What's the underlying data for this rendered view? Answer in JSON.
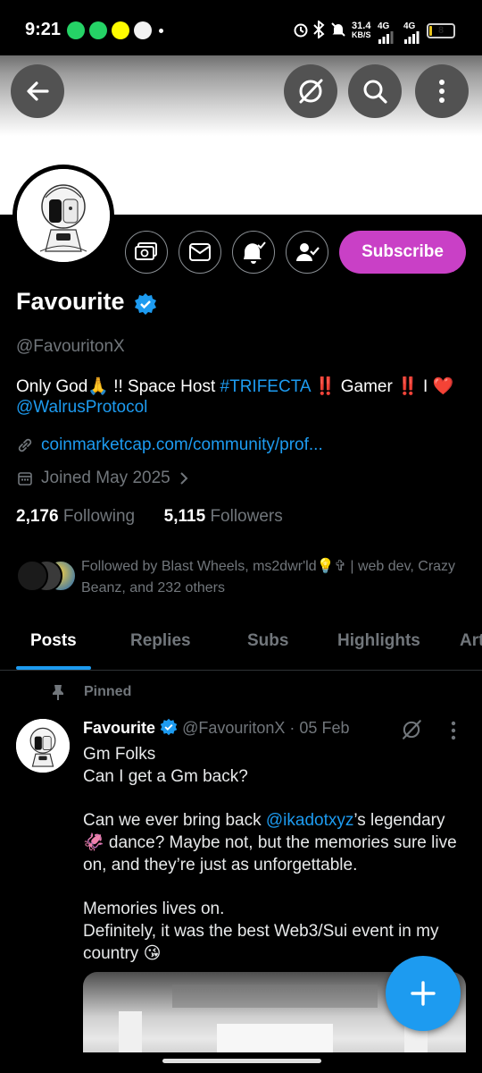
{
  "status_bar": {
    "time": "9:21",
    "net_speed_top": "31.4",
    "net_speed_unit": "KB/S",
    "signal1_label": "4G",
    "signal2_label": "4G",
    "battery_level": "8",
    "battery_fraction": 0.08,
    "colors": {
      "battery_fill": "#e8c31b"
    }
  },
  "header": {
    "back_icon": "arrow-left-icon",
    "grok_icon": "slash-circle-icon",
    "search_icon": "search-icon",
    "more_icon": "more-vertical-icon"
  },
  "profile": {
    "display_name": "Favourite",
    "handle": "@FavouritonX",
    "bio": {
      "part1": "Only God🙏 !! Space Host ",
      "hashtag": "#TRIFECTA",
      "part2": " ‼️ Gamer ‼️ I ❤️",
      "mention": "@WalrusProtocol"
    },
    "website": "coinmarketcap.com/community/prof...",
    "joined": "Joined May 2025",
    "following_count": "2,176",
    "following_label": "Following",
    "followers_count": "5,115",
    "followers_label": "Followers",
    "followed_by": "Followed by Blast Wheels, ms2dwr'ld💡✞ | web dev, Crazy Beanz, and 232 others",
    "subscribe_label": "Subscribe",
    "colors": {
      "accent": "#1d9bf0",
      "subscribe": "#c940c6"
    }
  },
  "tabs": [
    {
      "label": "Posts",
      "active": true
    },
    {
      "label": "Replies",
      "active": false
    },
    {
      "label": "Subs",
      "active": false
    },
    {
      "label": "Highlights",
      "active": false
    },
    {
      "label": "Art",
      "active": false
    }
  ],
  "pinned_post": {
    "pinned_label": "Pinned",
    "author_name": "Favourite",
    "author_handle": "@FavouritonX",
    "separator": "·",
    "date": "05 Feb",
    "line1": "Gm Folks",
    "line2": "Can I get a Gm back?",
    "para2_pre": "Can we ever bring back ",
    "para2_mention": "@ikadotxyz",
    "para2_post": "’s legendary 🦑 dance? Maybe not, but the memories sure live on, and they’re just as unforgettable.",
    "para3_line1": "Memories lives on.",
    "para3_line2": "Definitely, it was the best Web3/Sui event in my country 😘"
  },
  "fab": {
    "icon": "plus-icon"
  }
}
